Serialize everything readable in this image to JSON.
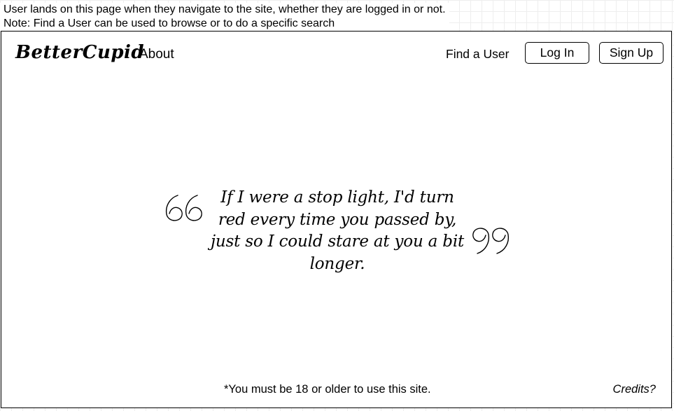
{
  "annotation": {
    "line1": "User lands on this page when they navigate to the site, whether they are logged in or not.",
    "line2": "Note: Find a User can be used to browse or to do a specific search"
  },
  "header": {
    "logo": "BetterCupid",
    "about_label": "About",
    "find_user_label": "Find a User",
    "login_label": "Log In",
    "signup_label": "Sign Up"
  },
  "quote": {
    "text": "If I were a stop light, I'd turn red every time you passed by, just so I could stare at you a bit longer.",
    "open_icon": "open-quote-icon",
    "close_icon": "close-quote-icon"
  },
  "footer": {
    "disclaimer": "*You must be 18 or older to use this site.",
    "credits_label": "Credits?"
  }
}
